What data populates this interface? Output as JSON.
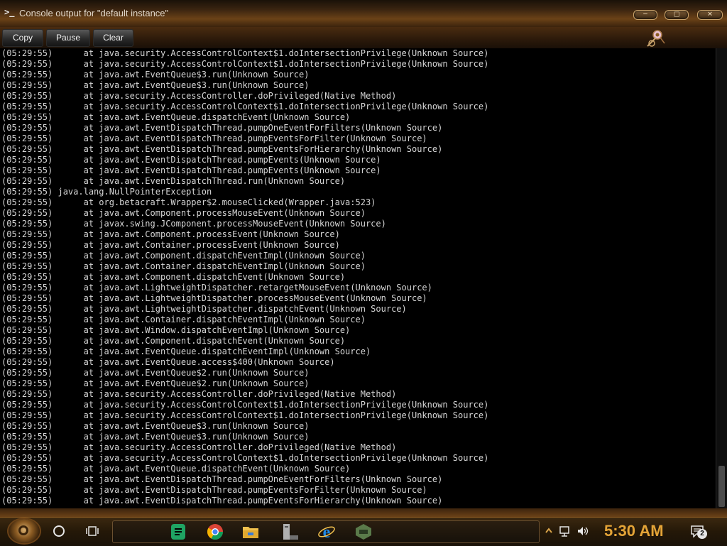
{
  "window": {
    "title": "Console output for \"default instance\"",
    "title_icon_glyph": ">_",
    "controls": [
      {
        "name": "minimize-button",
        "glyph": "─"
      },
      {
        "name": "maximize-button",
        "glyph": "□"
      },
      {
        "name": "close-button",
        "glyph": "✕"
      }
    ]
  },
  "toolbar": {
    "copy_label": "Copy",
    "pause_label": "Pause",
    "clear_label": "Clear"
  },
  "console": {
    "lines": [
      "(05:29:55)      at java.security.AccessControlContext$1.doIntersectionPrivilege(Unknown Source)",
      "(05:29:55)      at java.security.AccessControlContext$1.doIntersectionPrivilege(Unknown Source)",
      "(05:29:55)      at java.awt.EventQueue$3.run(Unknown Source)",
      "(05:29:55)      at java.awt.EventQueue$3.run(Unknown Source)",
      "(05:29:55)      at java.security.AccessController.doPrivileged(Native Method)",
      "(05:29:55)      at java.security.AccessControlContext$1.doIntersectionPrivilege(Unknown Source)",
      "(05:29:55)      at java.awt.EventQueue.dispatchEvent(Unknown Source)",
      "(05:29:55)      at java.awt.EventDispatchThread.pumpOneEventForFilters(Unknown Source)",
      "(05:29:55)      at java.awt.EventDispatchThread.pumpEventsForFilter(Unknown Source)",
      "(05:29:55)      at java.awt.EventDispatchThread.pumpEventsForHierarchy(Unknown Source)",
      "(05:29:55)      at java.awt.EventDispatchThread.pumpEvents(Unknown Source)",
      "(05:29:55)      at java.awt.EventDispatchThread.pumpEvents(Unknown Source)",
      "(05:29:55)      at java.awt.EventDispatchThread.run(Unknown Source)",
      "(05:29:55) java.lang.NullPointerException",
      "(05:29:55)      at org.betacraft.Wrapper$2.mouseClicked(Wrapper.java:523)",
      "(05:29:55)      at java.awt.Component.processMouseEvent(Unknown Source)",
      "(05:29:55)      at javax.swing.JComponent.processMouseEvent(Unknown Source)",
      "(05:29:55)      at java.awt.Component.processEvent(Unknown Source)",
      "(05:29:55)      at java.awt.Container.processEvent(Unknown Source)",
      "(05:29:55)      at java.awt.Component.dispatchEventImpl(Unknown Source)",
      "(05:29:55)      at java.awt.Container.dispatchEventImpl(Unknown Source)",
      "(05:29:55)      at java.awt.Component.dispatchEvent(Unknown Source)",
      "(05:29:55)      at java.awt.LightweightDispatcher.retargetMouseEvent(Unknown Source)",
      "(05:29:55)      at java.awt.LightweightDispatcher.processMouseEvent(Unknown Source)",
      "(05:29:55)      at java.awt.LightweightDispatcher.dispatchEvent(Unknown Source)",
      "(05:29:55)      at java.awt.Container.dispatchEventImpl(Unknown Source)",
      "(05:29:55)      at java.awt.Window.dispatchEventImpl(Unknown Source)",
      "(05:29:55)      at java.awt.Component.dispatchEvent(Unknown Source)",
      "(05:29:55)      at java.awt.EventQueue.dispatchEventImpl(Unknown Source)",
      "(05:29:55)      at java.awt.EventQueue.access$400(Unknown Source)",
      "(05:29:55)      at java.awt.EventQueue$2.run(Unknown Source)",
      "(05:29:55)      at java.awt.EventQueue$2.run(Unknown Source)",
      "(05:29:55)      at java.security.AccessController.doPrivileged(Native Method)",
      "(05:29:55)      at java.security.AccessControlContext$1.doIntersectionPrivilege(Unknown Source)",
      "(05:29:55)      at java.security.AccessControlContext$1.doIntersectionPrivilege(Unknown Source)",
      "(05:29:55)      at java.awt.EventQueue$3.run(Unknown Source)",
      "(05:29:55)      at java.awt.EventQueue$3.run(Unknown Source)",
      "(05:29:55)      at java.security.AccessController.doPrivileged(Native Method)",
      "(05:29:55)      at java.security.AccessControlContext$1.doIntersectionPrivilege(Unknown Source)",
      "(05:29:55)      at java.awt.EventQueue.dispatchEvent(Unknown Source)",
      "(05:29:55)      at java.awt.EventDispatchThread.pumpOneEventForFilters(Unknown Source)",
      "(05:29:55)      at java.awt.EventDispatchThread.pumpEventsForFilter(Unknown Source)",
      "(05:29:55)      at java.awt.EventDispatchThread.pumpEventsForHierarchy(Unknown Source)"
    ]
  },
  "taskbar": {
    "apps": [
      {
        "name": "spreadsheet-app-icon",
        "color": "#1fa463"
      },
      {
        "name": "chrome-icon",
        "color": "#db4437"
      },
      {
        "name": "file-explorer-icon",
        "color": "#f2c14e"
      },
      {
        "name": "server-app-icon",
        "color": "#b0b0b0"
      },
      {
        "name": "internet-explorer-icon",
        "color": "#1e88e5"
      },
      {
        "name": "game-launcher-icon",
        "color": "#5a7a4a"
      }
    ],
    "clock": "5:30 AM",
    "notification_count": "2"
  },
  "colors": {
    "console_text": "#d6d6d6",
    "clock_text": "#e4a437",
    "frame_brown": "#6b4217"
  }
}
